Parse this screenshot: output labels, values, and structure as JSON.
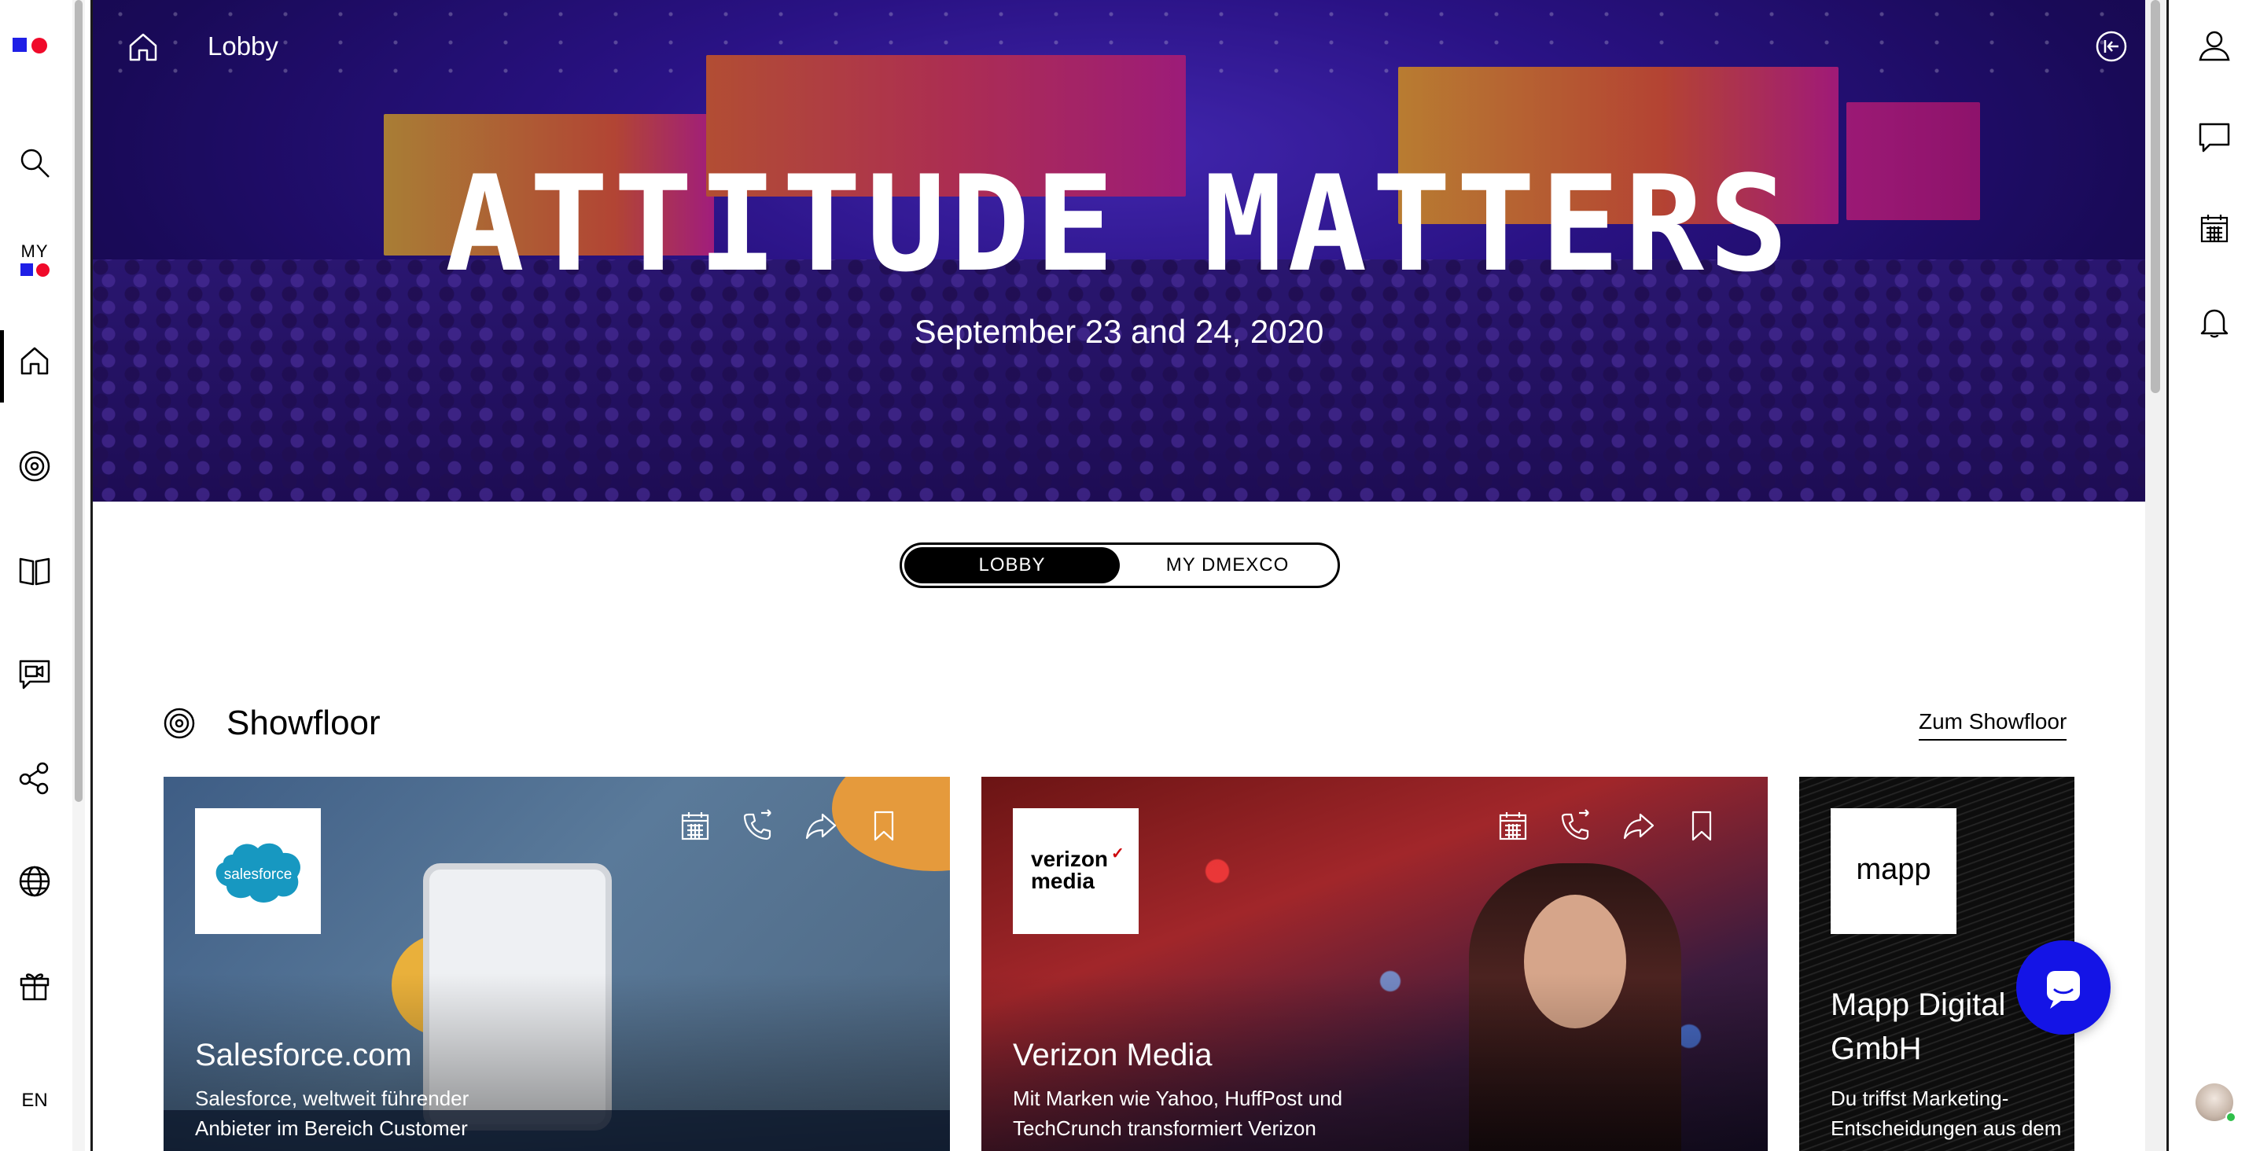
{
  "colors": {
    "brand_blue": "#1f1fe6",
    "brand_red": "#f00a2a",
    "chat_blue": "#1414e6"
  },
  "left_rail": {
    "my_label": "MY",
    "items": [
      {
        "icon": "search-icon"
      },
      {
        "icon": "my-dmexco-icon"
      },
      {
        "icon": "home-icon",
        "active": true
      },
      {
        "icon": "showfloor-target-icon"
      },
      {
        "icon": "book-icon"
      },
      {
        "icon": "video-chat-icon"
      },
      {
        "icon": "network-icon"
      },
      {
        "icon": "globe-icon"
      },
      {
        "icon": "gift-icon"
      }
    ],
    "language": "EN"
  },
  "hero": {
    "breadcrumb": "Lobby",
    "title": "ATTITUDE MATTERS",
    "date": "September 23 and 24, 2020"
  },
  "toggle": {
    "lobby": "LOBBY",
    "my_dmexco": "MY DMEXCO",
    "selected": "LOBBY"
  },
  "showfloor": {
    "title": "Showfloor",
    "link": "Zum Showfloor",
    "cards": [
      {
        "logo_text": "salesforce",
        "name": "Salesforce.com",
        "description": "Salesforce, weltweit führender Anbieter im Bereich Customer"
      },
      {
        "logo_text_1": "verizon",
        "logo_check": "✓",
        "logo_text_2": "media",
        "name": "Verizon Media",
        "description": "Mit Marken wie Yahoo, HuffPost und TechCrunch transformiert Verizon"
      },
      {
        "logo_text": "mapp",
        "name": "Mapp Digital GmbH",
        "description": "Du triffst Marketing-Entscheidungen aus dem"
      }
    ]
  },
  "right_rail": {
    "items": [
      "profile-icon",
      "messages-icon",
      "calendar-icon",
      "notifications-icon"
    ]
  }
}
